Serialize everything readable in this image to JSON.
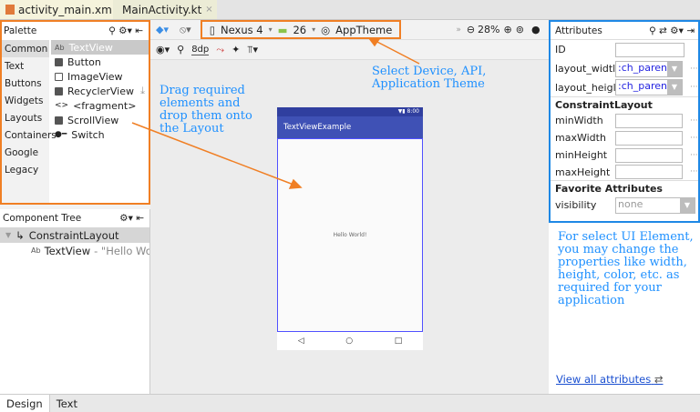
{
  "tabs": [
    {
      "label": "activity_main.xml",
      "close": "×"
    },
    {
      "label": "MainActivity.kt",
      "close": "×"
    }
  ],
  "toolbar": {
    "device": "Nexus 4",
    "api": "26",
    "theme": "AppTheme",
    "zoom": "28%",
    "margin": "8dp"
  },
  "palette": {
    "title": "Palette",
    "categories": [
      "Common",
      "Text",
      "Buttons",
      "Widgets",
      "Layouts",
      "Containers",
      "Google",
      "Legacy"
    ],
    "items": [
      {
        "icon": "Ab",
        "label": "TextView"
      },
      {
        "icon": "button",
        "label": "Button"
      },
      {
        "icon": "image",
        "label": "ImageView"
      },
      {
        "icon": "list",
        "label": "RecyclerView"
      },
      {
        "icon": "<>",
        "label": "<fragment>"
      },
      {
        "icon": "scroll",
        "label": "ScrollView"
      },
      {
        "icon": "switch",
        "label": "Switch"
      }
    ]
  },
  "tree": {
    "title": "Component Tree",
    "root": "ConstraintLayout",
    "child_icon": "Ab",
    "child": "TextView",
    "child_text": "- \"Hello World"
  },
  "phone": {
    "time": "8:00",
    "app_title": "TextViewExample",
    "content": "Hello World!"
  },
  "attributes": {
    "title": "Attributes",
    "id_label": "ID",
    "layout_width_label": "layout_widtl",
    "layout_width": ":ch_parent",
    "layout_height_label": "layout_heigl",
    "layout_height": ":ch_parent",
    "section1": "ConstraintLayout",
    "fields": [
      "minWidth",
      "maxWidth",
      "minHeight",
      "maxHeight"
    ],
    "section2": "Favorite Attributes",
    "visibility_label": "visibility",
    "visibility": "none",
    "view_all": "View all attributes"
  },
  "annotations": {
    "device": "Select Device, API,\nApplication Theme",
    "drag": "Drag required\nelements and\ndrop them onto\nthe Layout",
    "props": "For select UI Element,\nyou may change the\nproperties like width,\nheight, color, etc. as\nrequired for your\napplication"
  },
  "bottom_tabs": [
    "Design",
    "Text"
  ],
  "colors": {
    "orange": "#f07f24",
    "blue": "#1e88e5",
    "appbar": "#3f51b5",
    "statusbar": "#303f9f"
  }
}
